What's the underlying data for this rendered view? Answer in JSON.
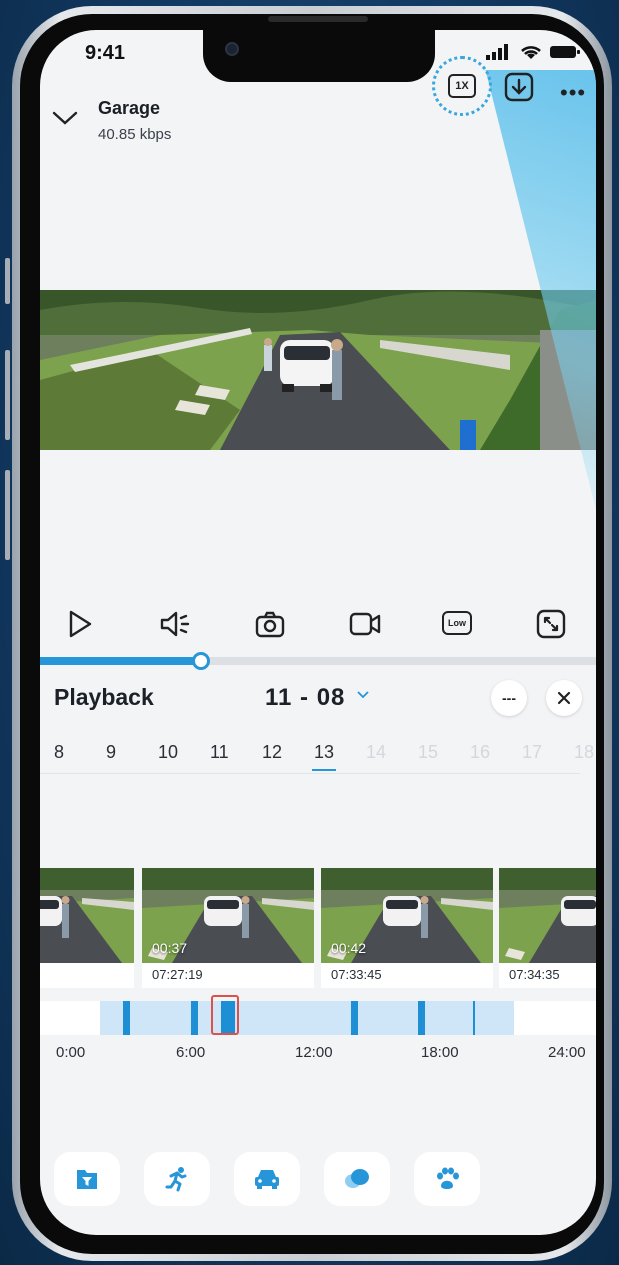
{
  "status": {
    "time": "9:41"
  },
  "camera": {
    "name": "Garage",
    "bitrate": "40.85 kbps"
  },
  "toolbar": {
    "speed_label": "1X"
  },
  "controls": {
    "quality_label": "Low"
  },
  "playback": {
    "title": "Playback",
    "date": "11 - 08",
    "more_label": "---",
    "progress_fraction": 0.29,
    "days": [
      "8",
      "9",
      "10",
      "11",
      "12",
      "13",
      "14",
      "15",
      "16",
      "17",
      "18"
    ],
    "active_day": "13"
  },
  "clips": [
    {
      "duration": "",
      "timestamp": ""
    },
    {
      "duration": "00:37",
      "timestamp": "07:27:19"
    },
    {
      "duration": "00:42",
      "timestamp": "07:33:45"
    },
    {
      "duration": "",
      "timestamp": "07:34:35"
    }
  ],
  "timeline": {
    "hours": [
      "0:00",
      "6:00",
      "12:00",
      "18:00",
      "24:00"
    ]
  },
  "colors": {
    "accent": "#2696d8",
    "cursor": "#e0504a",
    "band": "#cfe6f8"
  },
  "filters": [
    {
      "icon": "filter-folder-icon"
    },
    {
      "icon": "person-running-icon"
    },
    {
      "icon": "car-icon"
    },
    {
      "icon": "motion-blob-icon"
    },
    {
      "icon": "pet-paw-icon"
    }
  ]
}
